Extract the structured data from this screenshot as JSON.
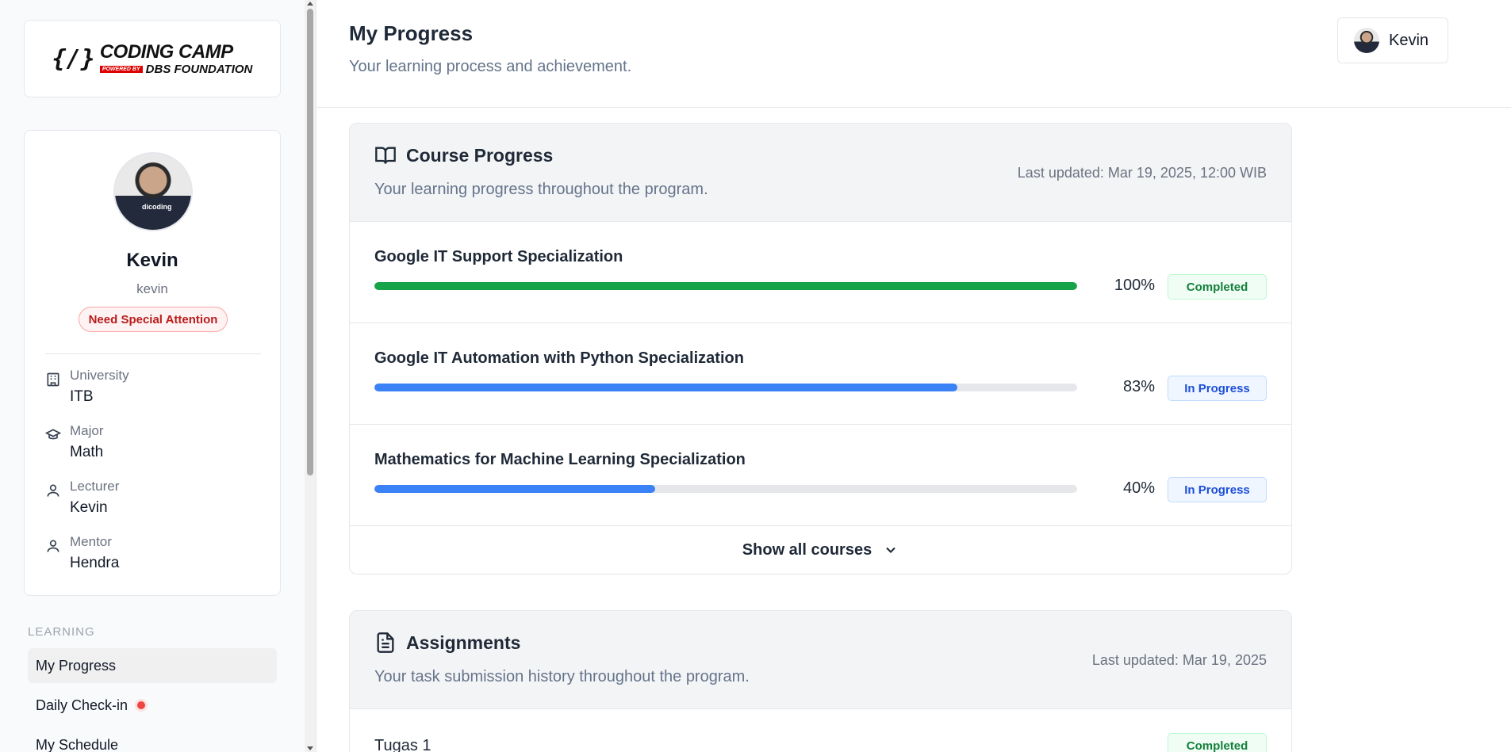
{
  "sidebar": {
    "logo": {
      "brace": "{/}",
      "main": "CODING CAMP",
      "powered": "POWERED BY",
      "org": "DBS FOUNDATION"
    },
    "profile": {
      "name": "Kevin",
      "username": "kevin",
      "status_badge": "Need Special Attention",
      "shirt_text": "dicoding",
      "info": [
        {
          "label": "University",
          "value": "ITB",
          "icon": "building-icon"
        },
        {
          "label": "Major",
          "value": "Math",
          "icon": "graduation-cap-icon"
        },
        {
          "label": "Lecturer",
          "value": "Kevin",
          "icon": "user-icon"
        },
        {
          "label": "Mentor",
          "value": "Hendra",
          "icon": "user-icon"
        }
      ]
    },
    "nav_section": "LEARNING",
    "nav_items": [
      {
        "label": "My Progress",
        "active": true
      },
      {
        "label": "Daily Check-in",
        "notification": true
      },
      {
        "label": "My Schedule"
      }
    ]
  },
  "header": {
    "title": "My Progress",
    "subtitle": "Your learning process and achievement.",
    "user_name": "Kevin"
  },
  "course_progress": {
    "title": "Course Progress",
    "subtitle": "Your learning progress throughout the program.",
    "last_updated": "Last updated: Mar 19, 2025, 12:00 WIB",
    "courses": [
      {
        "name": "Google IT Support Specialization",
        "progress": 100,
        "percent_label": "100%",
        "status": "Completed",
        "color": "#16a34a"
      },
      {
        "name": "Google IT Automation with Python Specialization",
        "progress": 83,
        "percent_label": "83%",
        "status": "In Progress",
        "color": "#3b82f6"
      },
      {
        "name": "Mathematics for Machine Learning Specialization",
        "progress": 40,
        "percent_label": "40%",
        "status": "In Progress",
        "color": "#3b82f6"
      }
    ],
    "show_all_label": "Show all courses"
  },
  "assignments": {
    "title": "Assignments",
    "subtitle": "Your task submission history throughout the program.",
    "last_updated": "Last updated: Mar 19, 2025",
    "items": [
      {
        "name": "Tugas 1",
        "status": "Completed"
      }
    ]
  }
}
